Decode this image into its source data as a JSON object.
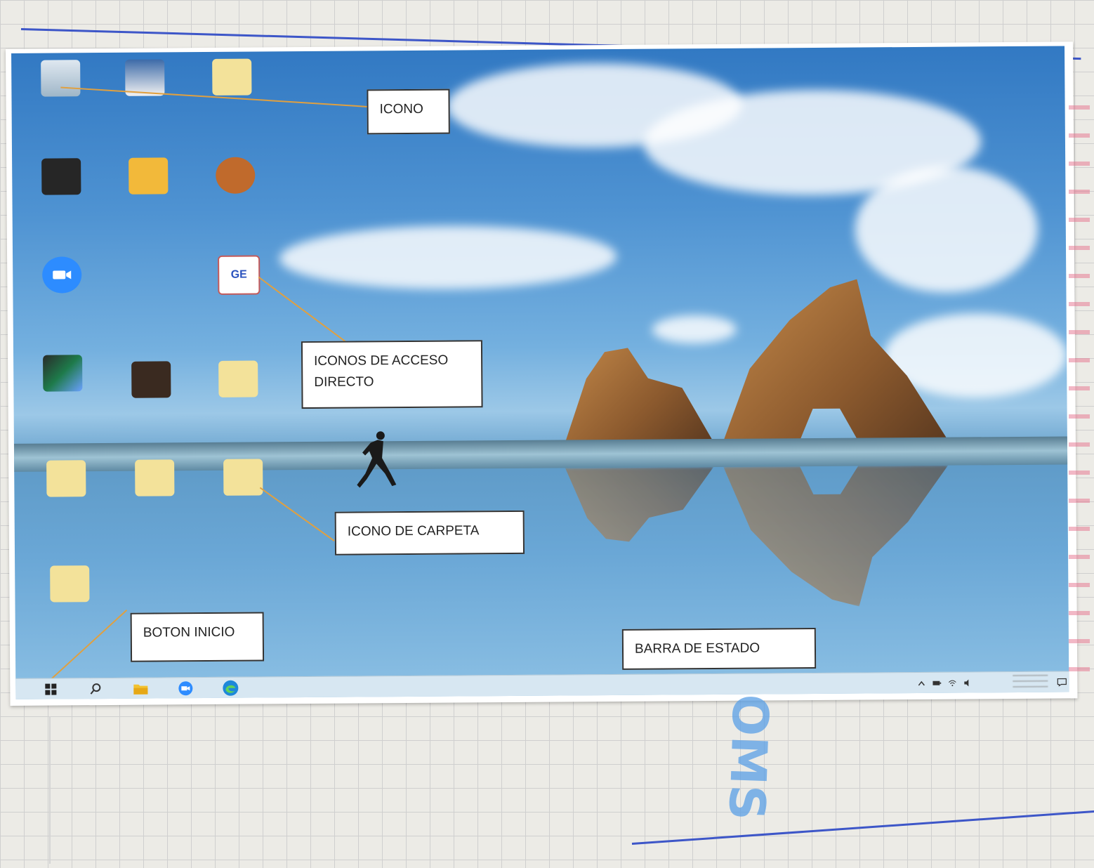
{
  "callouts": {
    "icono": "ICONO",
    "iconos_acceso_directo": "ICONOS DE ACCESO DIRECTO",
    "icono_carpeta": "ICONO DE CARPETA",
    "boton_inicio": "BOTON INICIO",
    "barra_estado": "BARRA DE ESTADO"
  },
  "handwriting": {
    "blue_vertical": "OMS"
  },
  "desktop_icons": [
    {
      "name": "recycle-bin",
      "icon": "recycle-bin-icon"
    },
    {
      "name": "app-shortcut",
      "icon": "app-shortcut-icon"
    },
    {
      "name": "folder",
      "icon": "folder-icon"
    },
    {
      "name": "dark-app",
      "icon": "app-icon"
    },
    {
      "name": "document-shortcut",
      "icon": "document-icon"
    },
    {
      "name": "baseball-glove",
      "icon": "game-icon"
    },
    {
      "name": "zoom",
      "icon": "video-camera-icon"
    },
    {
      "name": "ge-shortcut",
      "icon": "building-icon"
    },
    {
      "name": "video-editor",
      "icon": "video-editor-icon"
    },
    {
      "name": "media-app",
      "icon": "media-icon"
    },
    {
      "name": "folder-2",
      "icon": "folder-icon"
    },
    {
      "name": "folder-3",
      "icon": "folder-icon"
    },
    {
      "name": "folder-4",
      "icon": "folder-icon"
    },
    {
      "name": "folder-5",
      "icon": "folder-icon"
    },
    {
      "name": "folder-6",
      "icon": "folder-icon"
    }
  ],
  "taskbar": {
    "items": [
      "start-icon",
      "search-icon",
      "file-explorer-icon",
      "zoom-icon",
      "edge-icon"
    ],
    "tray_icons": [
      "chevron-up-icon",
      "battery-icon",
      "network-icon",
      "volume-icon"
    ],
    "notification_icon": "notification-icon"
  },
  "colors": {
    "callout_arrow": "#e0a040",
    "notebook_line": "#3d56c8",
    "handwriting_blue": "#5aa0e6",
    "handwriting_red": "#e6708c"
  }
}
